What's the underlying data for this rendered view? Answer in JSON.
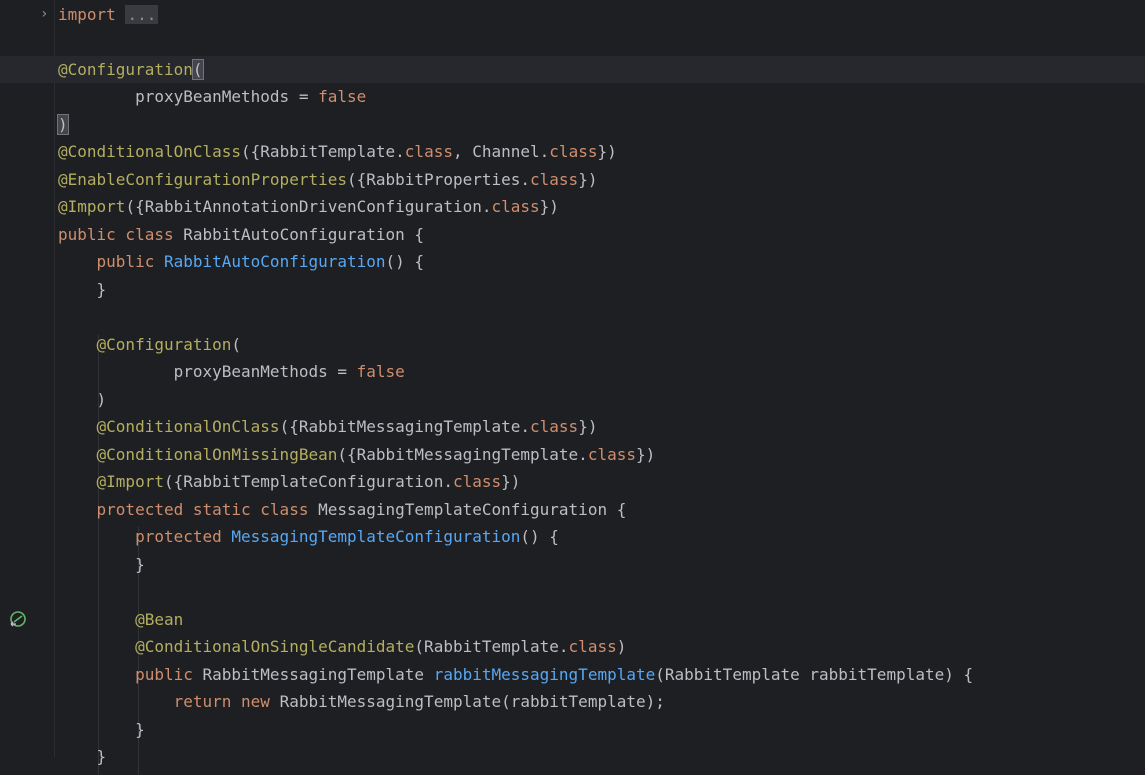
{
  "editor": {
    "colors": {
      "background": "#1e1f22",
      "annotation": "#b3ae60",
      "keyword": "#cf8e6d",
      "method": "#56a8f5",
      "text": "#bcbec4"
    },
    "gutter": {
      "fold_icon": "chevron-right-icon",
      "bean_icon": "bean-gutter-icon"
    },
    "lines": [
      {
        "tokens": [
          [
            "kw",
            "import"
          ],
          [
            "plain",
            " "
          ],
          [
            "fold",
            "..."
          ]
        ]
      },
      {
        "tokens": []
      },
      {
        "current": true,
        "tokens": [
          [
            "ann",
            "@Configuration"
          ],
          [
            "caret",
            "("
          ]
        ]
      },
      {
        "tokens": [
          [
            "plain",
            "        proxyBeanMethods = "
          ],
          [
            "kw",
            "false"
          ]
        ]
      },
      {
        "tokens": [
          [
            "caret",
            ")"
          ]
        ]
      },
      {
        "tokens": [
          [
            "ann",
            "@ConditionalOnClass"
          ],
          [
            "plain",
            "({RabbitTemplate."
          ],
          [
            "kw",
            "class"
          ],
          [
            "plain",
            ", Channel."
          ],
          [
            "kw",
            "class"
          ],
          [
            "plain",
            "})"
          ]
        ]
      },
      {
        "tokens": [
          [
            "ann",
            "@EnableConfigurationProperties"
          ],
          [
            "plain",
            "({RabbitProperties."
          ],
          [
            "kw",
            "class"
          ],
          [
            "plain",
            "})"
          ]
        ]
      },
      {
        "tokens": [
          [
            "ann",
            "@Import"
          ],
          [
            "plain",
            "({RabbitAnnotationDrivenConfiguration."
          ],
          [
            "kw",
            "class"
          ],
          [
            "plain",
            "})"
          ]
        ]
      },
      {
        "tokens": [
          [
            "kw",
            "public class "
          ],
          [
            "plain",
            "RabbitAutoConfiguration {"
          ]
        ]
      },
      {
        "tokens": [
          [
            "plain",
            "    "
          ],
          [
            "kw",
            "public "
          ],
          [
            "fn",
            "RabbitAutoConfiguration"
          ],
          [
            "plain",
            "() {"
          ]
        ]
      },
      {
        "tokens": [
          [
            "plain",
            "    }"
          ]
        ]
      },
      {
        "tokens": []
      },
      {
        "tokens": [
          [
            "plain",
            "    "
          ],
          [
            "ann",
            "@Configuration"
          ],
          [
            "plain",
            "("
          ]
        ]
      },
      {
        "tokens": [
          [
            "plain",
            "            proxyBeanMethods = "
          ],
          [
            "kw",
            "false"
          ]
        ]
      },
      {
        "tokens": [
          [
            "plain",
            "    )"
          ]
        ]
      },
      {
        "tokens": [
          [
            "plain",
            "    "
          ],
          [
            "ann",
            "@ConditionalOnClass"
          ],
          [
            "plain",
            "({RabbitMessagingTemplate."
          ],
          [
            "kw",
            "class"
          ],
          [
            "plain",
            "})"
          ]
        ]
      },
      {
        "tokens": [
          [
            "plain",
            "    "
          ],
          [
            "ann",
            "@ConditionalOnMissingBean"
          ],
          [
            "plain",
            "({RabbitMessagingTemplate."
          ],
          [
            "kw",
            "class"
          ],
          [
            "plain",
            "})"
          ]
        ]
      },
      {
        "tokens": [
          [
            "plain",
            "    "
          ],
          [
            "ann",
            "@Import"
          ],
          [
            "plain",
            "({RabbitTemplateConfiguration."
          ],
          [
            "kw",
            "class"
          ],
          [
            "plain",
            "})"
          ]
        ]
      },
      {
        "tokens": [
          [
            "plain",
            "    "
          ],
          [
            "kw",
            "protected static class "
          ],
          [
            "plain",
            "MessagingTemplateConfiguration {"
          ]
        ]
      },
      {
        "tokens": [
          [
            "plain",
            "        "
          ],
          [
            "kw",
            "protected "
          ],
          [
            "fn",
            "MessagingTemplateConfiguration"
          ],
          [
            "plain",
            "() {"
          ]
        ]
      },
      {
        "tokens": [
          [
            "plain",
            "        }"
          ]
        ]
      },
      {
        "tokens": []
      },
      {
        "tokens": [
          [
            "plain",
            "        "
          ],
          [
            "ann",
            "@Bean"
          ]
        ]
      },
      {
        "tokens": [
          [
            "plain",
            "        "
          ],
          [
            "ann",
            "@ConditionalOnSingleCandidate"
          ],
          [
            "plain",
            "(RabbitTemplate."
          ],
          [
            "kw",
            "class"
          ],
          [
            "plain",
            ")"
          ]
        ]
      },
      {
        "tokens": [
          [
            "plain",
            "        "
          ],
          [
            "kw",
            "public "
          ],
          [
            "plain",
            "RabbitMessagingTemplate "
          ],
          [
            "fn",
            "rabbitMessagingTemplate"
          ],
          [
            "plain",
            "(RabbitTemplate rabbitTemplate) {"
          ]
        ]
      },
      {
        "tokens": [
          [
            "plain",
            "            "
          ],
          [
            "kw",
            "return new "
          ],
          [
            "plain",
            "RabbitMessagingTemplate(rabbitTemplate);"
          ]
        ]
      },
      {
        "tokens": [
          [
            "plain",
            "        }"
          ]
        ]
      },
      {
        "tokens": [
          [
            "plain",
            "    }"
          ]
        ]
      }
    ]
  }
}
